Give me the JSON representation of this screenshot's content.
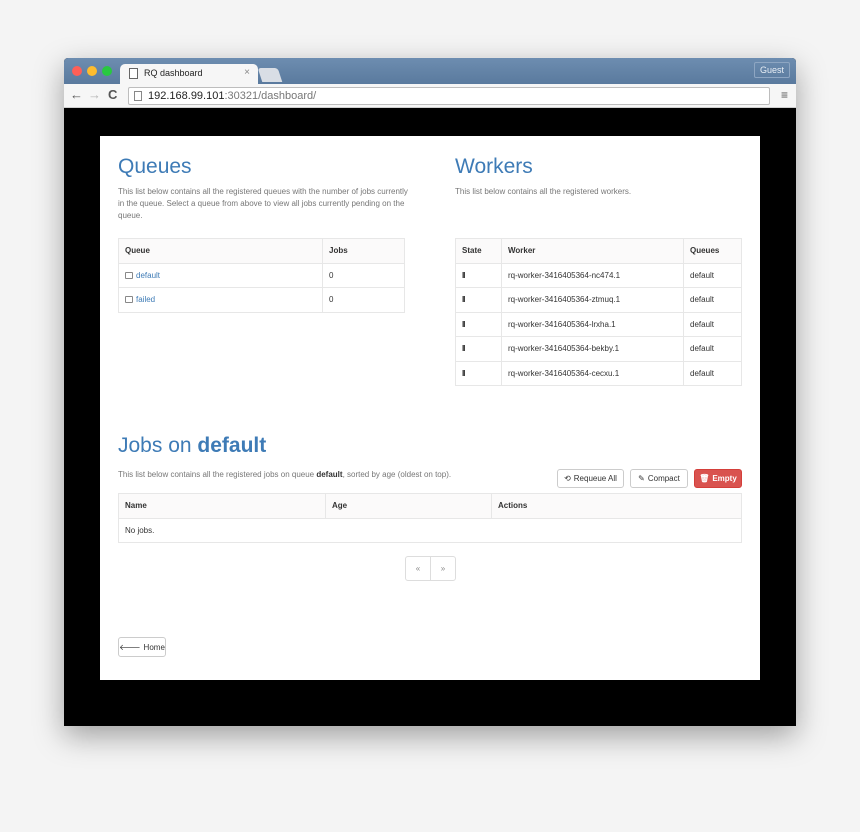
{
  "browser": {
    "tab_title": "RQ dashboard",
    "tab_close": "×",
    "guest_label": "Guest",
    "url_host": "192.168.99.101",
    "url_rest": ":30321/dashboard/",
    "back": "←",
    "forward": "→",
    "reload": "C",
    "menu": "≡"
  },
  "queues": {
    "title": "Queues",
    "description": "This list below contains all the registered queues with the number of jobs currently in the queue. Select a queue from above to view all jobs currently pending on the queue.",
    "headers": [
      "Queue",
      "Jobs"
    ],
    "rows": [
      {
        "name": "default",
        "jobs": "0"
      },
      {
        "name": "failed",
        "jobs": "0"
      }
    ]
  },
  "workers": {
    "title": "Workers",
    "description": "This list below contains all the registered workers.",
    "headers": [
      "State",
      "Worker",
      "Queues"
    ],
    "rows": [
      {
        "state": "II",
        "name": "rq-worker-3416405364-nc474.1",
        "queues": "default"
      },
      {
        "state": "II",
        "name": "rq-worker-3416405364-ztmuq.1",
        "queues": "default"
      },
      {
        "state": "II",
        "name": "rq-worker-3416405364-lrxha.1",
        "queues": "default"
      },
      {
        "state": "II",
        "name": "rq-worker-3416405364-bekby.1",
        "queues": "default"
      },
      {
        "state": "II",
        "name": "rq-worker-3416405364-cecxu.1",
        "queues": "default"
      }
    ]
  },
  "jobs": {
    "title_prefix": "Jobs on ",
    "title_queue": "default",
    "desc_prefix": "This list below contains all the registered jobs on queue ",
    "desc_queue": "default",
    "desc_suffix": ", sorted by age (oldest on top).",
    "headers": [
      "Name",
      "Age",
      "Actions"
    ],
    "empty_text": "No jobs.",
    "requeue_label": "Requeue All",
    "compact_label": "Compact",
    "empty_label": "Empty",
    "pager_prev": "«",
    "pager_next": "»"
  },
  "home_label": "Home",
  "colors": {
    "accent": "#3e7bb6",
    "danger": "#d9534f"
  }
}
